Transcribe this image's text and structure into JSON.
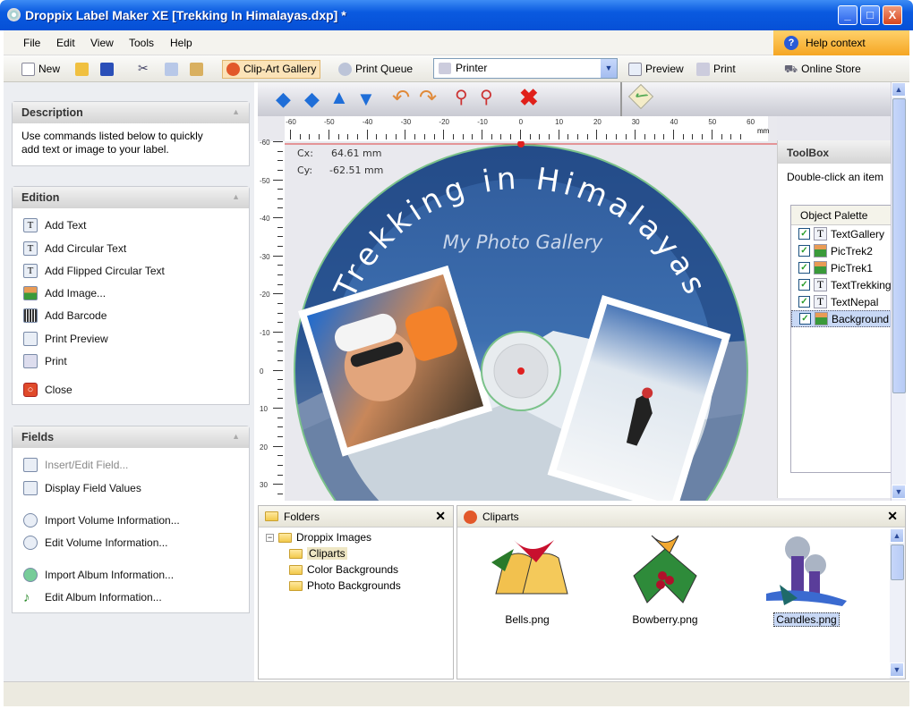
{
  "window": {
    "title": "Droppix Label Maker XE [Trekking In Himalayas.dxp] *",
    "minimize": "_",
    "maximize": "□",
    "close": "X"
  },
  "menu": [
    "File",
    "Edit",
    "View",
    "Tools",
    "Help"
  ],
  "help_context": "Help context",
  "toolbar": {
    "new": "New",
    "clipart": "Clip-Art Gallery",
    "print_queue": "Print Queue",
    "printer": "Printer",
    "preview": "Preview",
    "print": "Print",
    "online_store": "Online Store"
  },
  "description": {
    "title": "Description",
    "text": "Use commands listed below to quickly add text or image to your label."
  },
  "edition": {
    "title": "Edition",
    "items": [
      "Add Text",
      "Add Circular Text",
      "Add Flipped Circular Text",
      "Add Image...",
      "Add Barcode",
      "Print Preview",
      "Print",
      "Close"
    ]
  },
  "fields": {
    "title": "Fields",
    "items": [
      "Insert/Edit Field...",
      "Display Field Values",
      "Import Volume Information...",
      "Edit Volume Information...",
      "Import Album Information...",
      "Edit Album Information..."
    ]
  },
  "ruler": {
    "top": [
      "-60",
      "-50",
      "-40",
      "-30",
      "-20",
      "-10",
      "0",
      "10",
      "20",
      "30",
      "40",
      "50",
      "60"
    ],
    "unit": "mm",
    "left": [
      "-60",
      "-50",
      "-40",
      "-30",
      "-20",
      "-10",
      "0",
      "10",
      "20",
      "30"
    ]
  },
  "cursor": {
    "cx_label": "Cx:",
    "cx": "64.61 mm",
    "cy_label": "Cy:",
    "cy": "-62.51 mm"
  },
  "label": {
    "title": "Trekking in Himalayas",
    "subtitle": "My Photo Gallery"
  },
  "toolbox": {
    "title": "ToolBox",
    "hint": "Double-click an item in the list below to edit its properties",
    "palette_title": "Object Palette",
    "objects": [
      {
        "name": "TextGallery",
        "type": "text"
      },
      {
        "name": "PicTrek2",
        "type": "image"
      },
      {
        "name": "PicTrek1",
        "type": "image"
      },
      {
        "name": "TextTrekking",
        "type": "text"
      },
      {
        "name": "TextNepal",
        "type": "text"
      },
      {
        "name": "Background",
        "type": "image",
        "selected": true
      }
    ]
  },
  "folders": {
    "title": "Folders",
    "root": "Droppix Images",
    "children": [
      "Cliparts",
      "Color Backgrounds",
      "Photo Backgrounds"
    ],
    "selected": "Cliparts"
  },
  "cliparts": {
    "title": "Cliparts",
    "items": [
      "Bells.png",
      "Bowberry.png",
      "Candles.png"
    ],
    "selected": "Candles.png"
  }
}
